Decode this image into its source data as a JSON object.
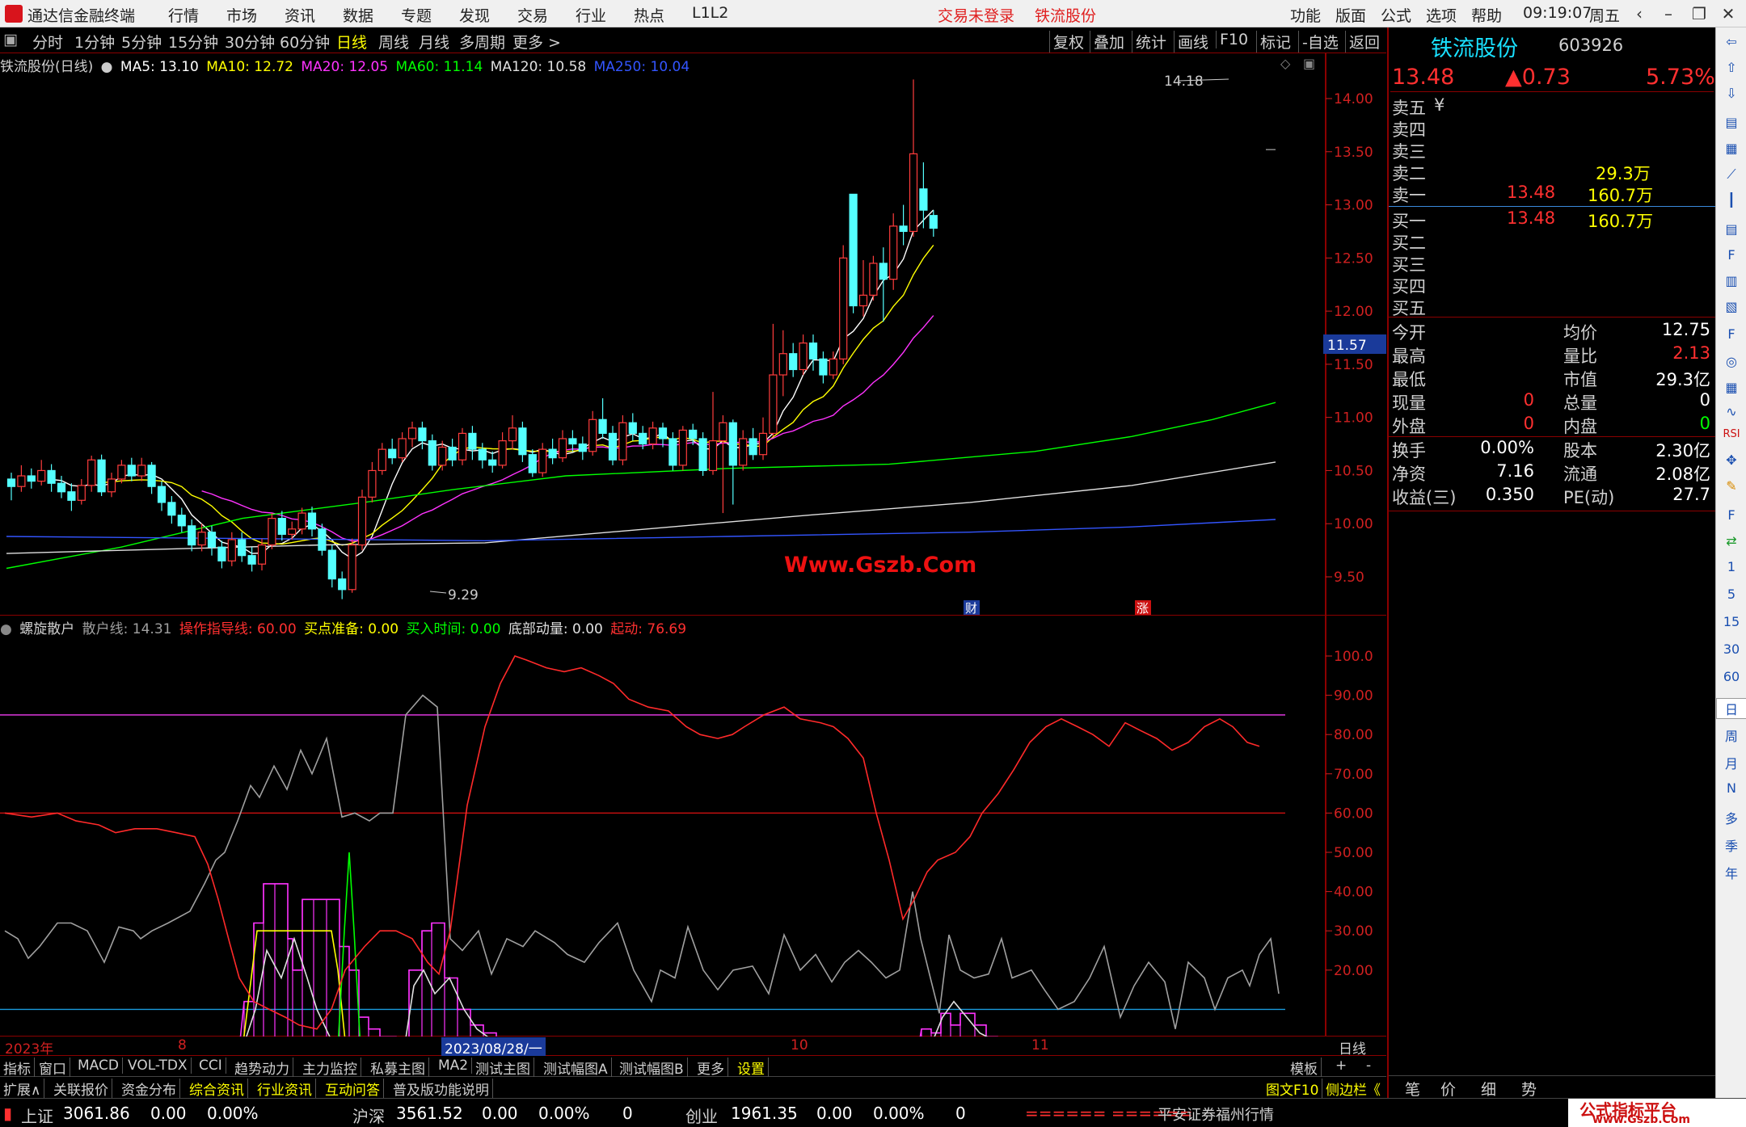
{
  "titlebar": {
    "app_title": "通达信金融终端",
    "menu": [
      "行情",
      "市场",
      "资讯",
      "数据",
      "专题",
      "发现",
      "交易",
      "行业",
      "热点",
      "L1L2"
    ],
    "login": "交易未登录",
    "stock": "铁流股份",
    "right_menu": [
      "功能",
      "版面",
      "公式",
      "选项",
      "帮助"
    ],
    "time": "09:19:07",
    "weekday": "周五"
  },
  "timeframes": {
    "items": [
      "分时",
      "1分钟",
      "5分钟",
      "15分钟",
      "30分钟",
      "60分钟",
      "日线",
      "周线",
      "月线",
      "多周期",
      "更多 >"
    ],
    "selected": "日线",
    "right_items": [
      "复权",
      "叠加",
      "统计",
      "画线",
      "F10",
      "标记",
      "-自选",
      "返回"
    ]
  },
  "main_chart": {
    "stock_label": "铁流股份(日线)",
    "ma": [
      {
        "label": "MA5: 13.10",
        "color": "#ffffff"
      },
      {
        "label": "MA10: 12.72",
        "color": "#ffff00"
      },
      {
        "label": "MA20: 12.05",
        "color": "#ff33ff"
      },
      {
        "label": "MA60: 11.14",
        "color": "#00ff00"
      },
      {
        "label": "MA120: 10.58",
        "color": "#e0e0e0"
      },
      {
        "label": "MA250: 10.04",
        "color": "#3355ff"
      }
    ],
    "y_ticks": [
      "14.00",
      "13.50",
      "13.00",
      "12.50",
      "12.00",
      "11.50",
      "11.00",
      "10.50",
      "10.00",
      "9.50"
    ],
    "current_price": "11.57",
    "high_label": "14.18",
    "low_label": "9.29",
    "marker_cai": "财",
    "marker_zhang": "涨",
    "watermark": "Www.Gszb.Com"
  },
  "indicator": {
    "name": "螺旋散户",
    "lines": [
      {
        "label": "散户线: 14.31",
        "color": "#a0a0a0"
      },
      {
        "label": "操作指导线: 60.00",
        "color": "#ff3030"
      },
      {
        "label": "买点准备: 0.00",
        "color": "#ffff00"
      },
      {
        "label": "买入时间: 0.00",
        "color": "#00ff00"
      },
      {
        "label": "底部动量: 0.00",
        "color": "#e0e0e0"
      },
      {
        "label": "起动: 76.69",
        "color": "#ff3030"
      }
    ],
    "y_ticks": [
      "100.0",
      "90.00",
      "80.00",
      "70.00",
      "60.00",
      "50.00",
      "40.00",
      "30.00",
      "20.00"
    ]
  },
  "x_axis": {
    "labels": [
      "2023年",
      "8",
      "2023/08/28/一",
      "10",
      "11"
    ],
    "period": "日线"
  },
  "tabs1": [
    "指标",
    "窗口",
    "MACD",
    "VOL-TDX",
    "CCI",
    "趋势动力",
    "主力监控",
    "私募主图",
    "MA2",
    "测试主图",
    "测试幅图A",
    "测试幅图B",
    "更多",
    "设置"
  ],
  "tabs1_right": [
    "模板",
    "+",
    "-"
  ],
  "tabs2": [
    "扩展∧",
    "关联报价",
    "资金分布",
    "综合资讯",
    "行业资讯",
    "互动问答",
    "普及版功能说明"
  ],
  "tabs2_right": [
    "图文F10",
    "侧边栏《"
  ],
  "quote": {
    "name": "铁流股份",
    "code": "603926",
    "price": "13.48",
    "change": "▲0.73",
    "pct": "5.73%",
    "asks": [
      {
        "label": "卖五",
        "price": "",
        "vol": ""
      },
      {
        "label": "卖四",
        "price": "",
        "vol": ""
      },
      {
        "label": "卖三",
        "price": "",
        "vol": ""
      },
      {
        "label": "卖二",
        "price": "",
        "vol": "29.3万"
      },
      {
        "label": "卖一",
        "price": "13.48",
        "vol": "160.7万"
      }
    ],
    "bids": [
      {
        "label": "买一",
        "price": "13.48",
        "vol": "160.7万"
      },
      {
        "label": "买二",
        "price": "",
        "vol": ""
      },
      {
        "label": "买三",
        "price": "",
        "vol": ""
      },
      {
        "label": "买四",
        "price": "",
        "vol": ""
      },
      {
        "label": "买五",
        "price": "",
        "vol": ""
      }
    ],
    "stats": [
      {
        "l1": "今开",
        "v1": "",
        "l2": "均价",
        "v2": "12.75",
        "c2": "#ffffff"
      },
      {
        "l1": "最高",
        "v1": "",
        "l2": "量比",
        "v2": "2.13",
        "c2": "#ff3030"
      },
      {
        "l1": "最低",
        "v1": "",
        "l2": "市值",
        "v2": "29.3亿",
        "c2": "#ffffff"
      },
      {
        "l1": "现量",
        "v1": "0",
        "c1": "#ff3030",
        "l2": "总量",
        "v2": "0",
        "c2": "#ffffff"
      },
      {
        "l1": "外盘",
        "v1": "0",
        "c1": "#ff3030",
        "l2": "内盘",
        "v2": "0",
        "c2": "#00ff00"
      }
    ],
    "fund": [
      {
        "l1": "换手",
        "v1": "0.00%",
        "l2": "股本",
        "v2": "2.30亿"
      },
      {
        "l1": "净资",
        "v1": "7.16",
        "l2": "流通",
        "v2": "2.08亿"
      },
      {
        "l1": "收益(三)",
        "v1": "0.350",
        "l2": "PE(动)",
        "v2": "27.7"
      }
    ],
    "bottom_tabs": [
      "笔",
      "价",
      "细",
      "势"
    ]
  },
  "statusbar": {
    "sh_label": "上证",
    "sh_val": "3061.86",
    "sh_chg": "0.00",
    "sh_pct": "0.00%",
    "sz_label": "沪深",
    "sz_val": "3561.52",
    "sz_chg": "0.00",
    "sz_pct": "0.00%",
    "sz_n": "0",
    "cy_label": "创业",
    "cy_val": "1961.35",
    "cy_chg": "0.00",
    "cy_pct": "0.00%",
    "cy_n": "0",
    "bars": "====== ======",
    "feed": "平安证券福州行情",
    "brand": "公式指标平台",
    "brand_url": "www.Gszb.Com"
  },
  "toolcol": [
    "1",
    "5",
    "15",
    "30",
    "60",
    "日",
    "周",
    "月",
    "N",
    "多",
    "季",
    "年"
  ]
}
